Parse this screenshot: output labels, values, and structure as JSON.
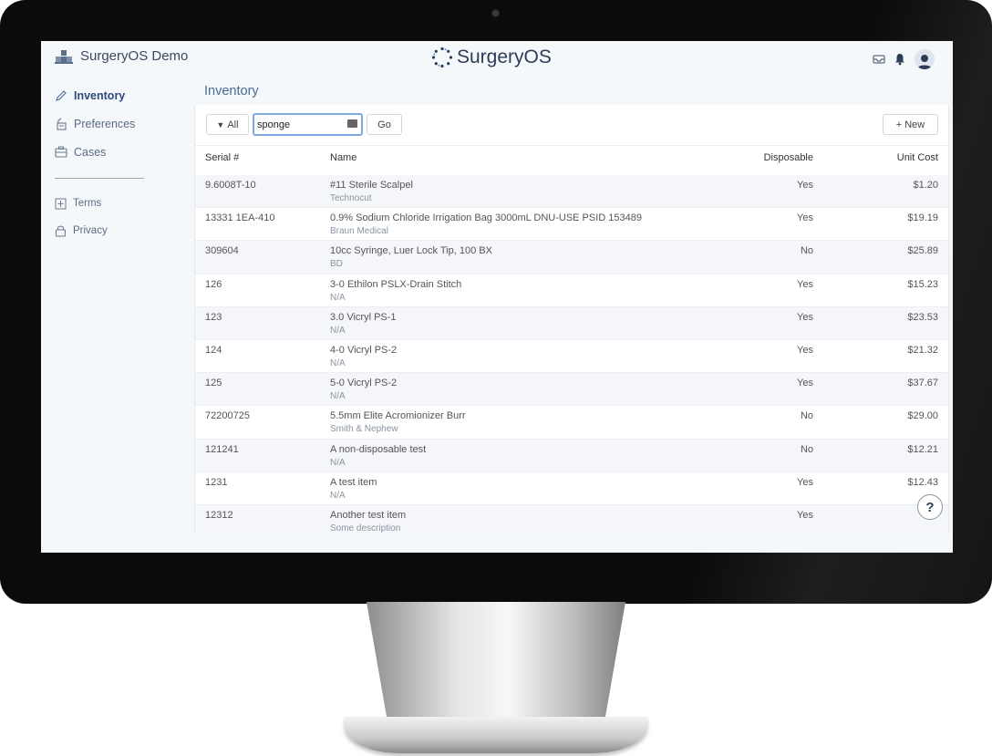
{
  "app": {
    "brand_name": "SurgeryOS Demo",
    "logo_text": "SurgeryOS"
  },
  "sidebar": {
    "items": [
      {
        "label": "Inventory",
        "icon": "pencil-icon",
        "active": true
      },
      {
        "label": "Preferences",
        "icon": "preferences-icon",
        "active": false
      },
      {
        "label": "Cases",
        "icon": "cases-icon",
        "active": false
      }
    ],
    "footer_items": [
      {
        "label": "Terms",
        "icon": "terms-icon"
      },
      {
        "label": "Privacy",
        "icon": "lock-icon"
      }
    ]
  },
  "page": {
    "title": "Inventory"
  },
  "toolbar": {
    "filter_label": "All",
    "search_value": "sponge",
    "go_label": "Go",
    "new_label": "New"
  },
  "table": {
    "headers": {
      "serial": "Serial #",
      "name": "Name",
      "disposable": "Disposable",
      "cost": "Unit Cost"
    },
    "rows": [
      {
        "serial": "9.6008T-10",
        "name": "#11 Sterile Scalpel",
        "vendor": "Technocut",
        "disposable": "Yes",
        "cost": "$1.20"
      },
      {
        "serial": "13331 1EA-410",
        "name": "0.9% Sodium Chloride Irrigation Bag 3000mL DNU-USE PSID 153489",
        "vendor": "Braun Medical",
        "disposable": "Yes",
        "cost": "$19.19"
      },
      {
        "serial": "309604",
        "name": "10cc Syringe, Luer Lock Tip, 100 BX",
        "vendor": "BD",
        "disposable": "No",
        "cost": "$25.89"
      },
      {
        "serial": "126",
        "name": "3-0 Ethilon PSLX-Drain Stitch",
        "vendor": "N/A",
        "disposable": "Yes",
        "cost": "$15.23"
      },
      {
        "serial": "123",
        "name": "3.0 Vicryl PS-1",
        "vendor": "N/A",
        "disposable": "Yes",
        "cost": "$23.53"
      },
      {
        "serial": "124",
        "name": "4-0 Vicryl PS-2",
        "vendor": "N/A",
        "disposable": "Yes",
        "cost": "$21.32"
      },
      {
        "serial": "125",
        "name": "5-0 Vicryl PS-2",
        "vendor": "N/A",
        "disposable": "Yes",
        "cost": "$37.67"
      },
      {
        "serial": "72200725",
        "name": "5.5mm Elite Acromionizer Burr",
        "vendor": "Smith & Nephew",
        "disposable": "No",
        "cost": "$29.00"
      },
      {
        "serial": "121241",
        "name": "A non-disposable test",
        "vendor": "N/A",
        "disposable": "No",
        "cost": "$12.21"
      },
      {
        "serial": "1231",
        "name": "A test item",
        "vendor": "N/A",
        "disposable": "Yes",
        "cost": "$12.43"
      },
      {
        "serial": "12312",
        "name": "Another test item",
        "vendor": "Some description",
        "disposable": "Yes",
        "cost": "$5"
      }
    ]
  },
  "help": {
    "label": "?"
  },
  "colors": {
    "accent": "#4a6a96",
    "bezel": "#0b0b0c",
    "screen_bg": "#f5f8fb"
  }
}
